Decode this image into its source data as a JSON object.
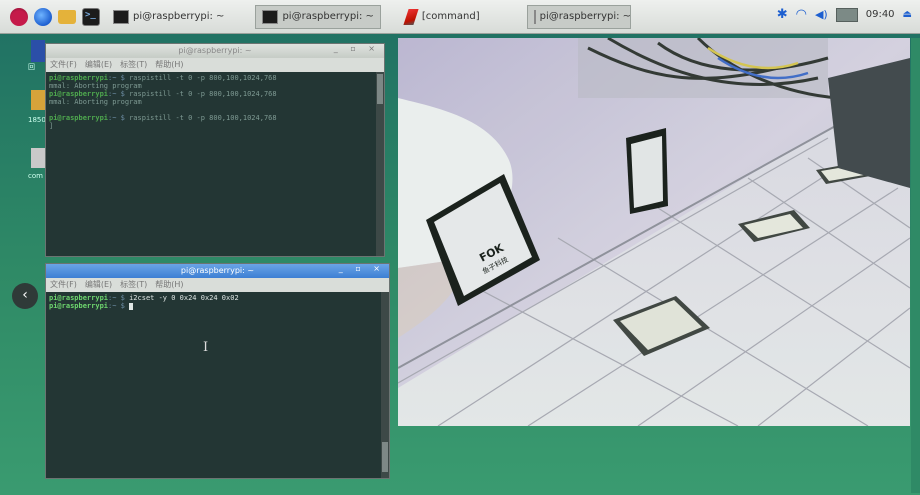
{
  "taskbar": {
    "tasks": [
      {
        "label": "pi@raspberrypi: ~",
        "active": false
      },
      {
        "label": "pi@raspberrypi: ~",
        "active": true
      },
      {
        "label": "[command]",
        "active": false
      },
      {
        "label": "pi@raspberrypi: ~",
        "active": false
      }
    ],
    "clock": "09:40"
  },
  "desktop": {
    "labels": [
      "回",
      "1850",
      "com"
    ]
  },
  "terminal_top": {
    "title": "pi@raspberrypi: ~",
    "menu": [
      "文件(F)",
      "编辑(E)",
      "标签(T)",
      "帮助(H)"
    ],
    "lines": [
      {
        "prompt": "pi@raspberrypi",
        "path": ":~ $",
        "cmd": " raspistill -t 0 -p 800,100,1024,768"
      },
      {
        "prompt": "",
        "path": "",
        "cmd": "mmal: Aborting program"
      },
      {
        "prompt": "pi@raspberrypi",
        "path": ":~ $",
        "cmd": " raspistill -t 0 -p 800,100,1024,768"
      },
      {
        "prompt": "",
        "path": "",
        "cmd": "mmal: Aborting program"
      },
      {
        "prompt": "",
        "path": "",
        "cmd": ""
      },
      {
        "prompt": "pi@raspberrypi",
        "path": ":~ $",
        "cmd": " raspistill -t 0 -p 800,100,1024,768"
      },
      {
        "prompt": "",
        "path": "",
        "cmd": "]"
      }
    ]
  },
  "terminal_bottom": {
    "title": "pi@raspberrypi: ~",
    "menu": [
      "文件(F)",
      "编辑(E)",
      "标签(T)",
      "帮助(H)"
    ],
    "lines": [
      {
        "prompt": "pi@raspberrypi",
        "path": ":~ $",
        "cmd": " i2cset -y 0 0x24 0x24 0x02"
      },
      {
        "prompt": "pi@raspberrypi",
        "path": ":~ $",
        "cmd": " "
      }
    ]
  },
  "preview": {
    "sign_text_1": "FOK",
    "sign_text_2": "鱼子科技"
  },
  "colors": {
    "desktop": "#2f8a66",
    "active_title": "#3d7fd4",
    "terminal_bg": "#233634",
    "prompt_green": "#4ea84e"
  }
}
